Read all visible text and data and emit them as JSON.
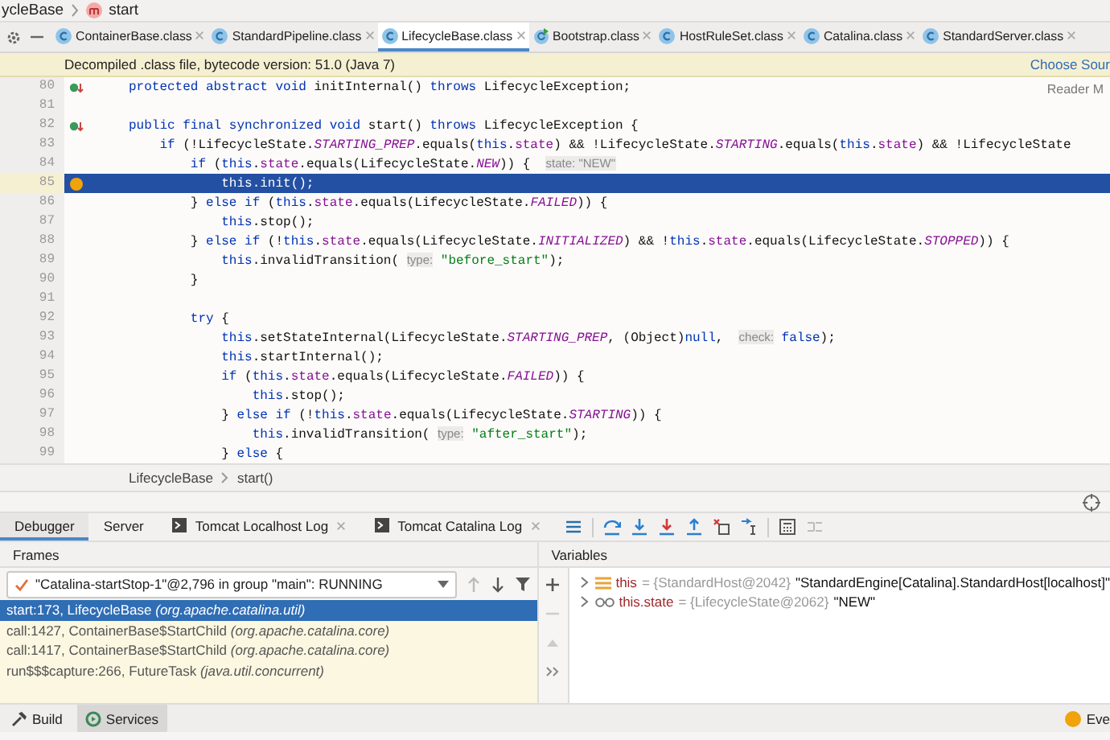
{
  "breadcrumb": {
    "class_name": "ycleBase",
    "method": "start"
  },
  "tabs": [
    {
      "label": "ContainerBase.class",
      "kind": "class",
      "selected": false
    },
    {
      "label": "StandardPipeline.class",
      "kind": "class",
      "selected": false
    },
    {
      "label": "LifecycleBase.class",
      "kind": "class",
      "selected": true
    },
    {
      "label": "Bootstrap.class",
      "kind": "runnable",
      "selected": false
    },
    {
      "label": "HostRuleSet.class",
      "kind": "class",
      "selected": false
    },
    {
      "label": "Catalina.class",
      "kind": "class",
      "selected": false
    },
    {
      "label": "StandardServer.class",
      "kind": "class",
      "selected": false
    }
  ],
  "notice": {
    "text": "Decompiled .class file, bytecode version: 51.0 (Java 7)",
    "link": "Choose Sour"
  },
  "editor": {
    "reader_mode": "Reader M",
    "lines": [
      {
        "number": "80",
        "kind": "implements",
        "current": false,
        "tokens": [
          {
            "kind": "k",
            "text": "protected abstract void "
          },
          {
            "kind": "p",
            "text": "initInternal() "
          },
          {
            "kind": "k",
            "text": "throws "
          },
          {
            "kind": "p",
            "text": "LifecycleException;"
          }
        ]
      },
      {
        "number": "81",
        "kind": "plain",
        "current": false
      },
      {
        "number": "82",
        "kind": "implements",
        "current": false,
        "tokens": [
          {
            "kind": "k",
            "text": "public final synchronized void "
          },
          {
            "kind": "p",
            "text": "start() "
          },
          {
            "kind": "k",
            "text": "throws "
          },
          {
            "kind": "p",
            "text": "LifecycleException {"
          }
        ]
      },
      {
        "number": "83",
        "kind": "plain",
        "current": false,
        "tokens": [
          {
            "kind": "k",
            "text": "    if "
          },
          {
            "kind": "p",
            "text": "(!LifecycleState."
          },
          {
            "kind": "c",
            "text": "STARTING_PREP"
          },
          {
            "kind": "p",
            "text": ".equals("
          },
          {
            "kind": "k",
            "text": "this"
          },
          {
            "kind": "p",
            "text": "."
          },
          {
            "kind": "f",
            "text": "state"
          },
          {
            "kind": "p",
            "text": ") && !LifecycleState."
          },
          {
            "kind": "c",
            "text": "STARTING"
          },
          {
            "kind": "p",
            "text": ".equals("
          },
          {
            "kind": "k",
            "text": "this"
          },
          {
            "kind": "p",
            "text": "."
          },
          {
            "kind": "f",
            "text": "state"
          },
          {
            "kind": "p",
            "text": ") && !LifecycleState"
          }
        ]
      },
      {
        "number": "84",
        "kind": "plain",
        "current": false,
        "tokens": [
          {
            "kind": "k",
            "text": "        if "
          },
          {
            "kind": "p",
            "text": "("
          },
          {
            "kind": "k",
            "text": "this"
          },
          {
            "kind": "p",
            "text": "."
          },
          {
            "kind": "f",
            "text": "state"
          },
          {
            "kind": "p",
            "text": ".equals(LifecycleState."
          },
          {
            "kind": "c",
            "text": "NEW"
          },
          {
            "kind": "p",
            "text": ")) {  "
          },
          {
            "kind": "h",
            "text": "state: \"NEW\""
          }
        ]
      },
      {
        "number": "85",
        "kind": "execution",
        "current": true,
        "tokens": [
          {
            "kind": "k",
            "text": "            this"
          },
          {
            "kind": "p",
            "text": ".init();"
          }
        ]
      },
      {
        "number": "86",
        "kind": "plain",
        "current": false,
        "tokens": [
          {
            "kind": "p",
            "text": "        } "
          },
          {
            "kind": "k",
            "text": "else if "
          },
          {
            "kind": "p",
            "text": "("
          },
          {
            "kind": "k",
            "text": "this"
          },
          {
            "kind": "p",
            "text": "."
          },
          {
            "kind": "f",
            "text": "state"
          },
          {
            "kind": "p",
            "text": ".equals(LifecycleState."
          },
          {
            "kind": "c",
            "text": "FAILED"
          },
          {
            "kind": "p",
            "text": ")) {"
          }
        ]
      },
      {
        "number": "87",
        "kind": "plain",
        "current": false,
        "tokens": [
          {
            "kind": "k",
            "text": "            this"
          },
          {
            "kind": "p",
            "text": ".stop();"
          }
        ]
      },
      {
        "number": "88",
        "kind": "plain",
        "current": false,
        "tokens": [
          {
            "kind": "p",
            "text": "        } "
          },
          {
            "kind": "k",
            "text": "else if "
          },
          {
            "kind": "p",
            "text": "(!"
          },
          {
            "kind": "k",
            "text": "this"
          },
          {
            "kind": "p",
            "text": "."
          },
          {
            "kind": "f",
            "text": "state"
          },
          {
            "kind": "p",
            "text": ".equals(LifecycleState."
          },
          {
            "kind": "c",
            "text": "INITIALIZED"
          },
          {
            "kind": "p",
            "text": ") && !"
          },
          {
            "kind": "k",
            "text": "this"
          },
          {
            "kind": "p",
            "text": "."
          },
          {
            "kind": "f",
            "text": "state"
          },
          {
            "kind": "p",
            "text": ".equals(LifecycleState."
          },
          {
            "kind": "c",
            "text": "STOPPED"
          },
          {
            "kind": "p",
            "text": ")) {"
          }
        ]
      },
      {
        "number": "89",
        "kind": "plain",
        "current": false,
        "tokens": [
          {
            "kind": "k",
            "text": "            this"
          },
          {
            "kind": "p",
            "text": ".invalidTransition( "
          },
          {
            "kind": "h",
            "text": "type:"
          },
          {
            "kind": "s",
            "text": " \"before_start\""
          },
          {
            "kind": "p",
            "text": ");"
          }
        ]
      },
      {
        "number": "90",
        "kind": "plain",
        "current": false,
        "tokens": [
          {
            "kind": "p",
            "text": "        }"
          }
        ]
      },
      {
        "number": "91",
        "kind": "plain",
        "current": false
      },
      {
        "number": "92",
        "kind": "plain",
        "current": false,
        "tokens": [
          {
            "kind": "k",
            "text": "        try "
          },
          {
            "kind": "p",
            "text": "{"
          }
        ]
      },
      {
        "number": "93",
        "kind": "plain",
        "current": false,
        "tokens": [
          {
            "kind": "k",
            "text": "            this"
          },
          {
            "kind": "p",
            "text": ".setStateInternal(LifecycleState."
          },
          {
            "kind": "c",
            "text": "STARTING_PREP"
          },
          {
            "kind": "p",
            "text": ", (Object)"
          },
          {
            "kind": "k",
            "text": "null"
          },
          {
            "kind": "p",
            "text": ",  "
          },
          {
            "kind": "h",
            "text": "check:"
          },
          {
            "kind": "k",
            "text": " false"
          },
          {
            "kind": "p",
            "text": ");"
          }
        ]
      },
      {
        "number": "94",
        "kind": "plain",
        "current": false,
        "tokens": [
          {
            "kind": "k",
            "text": "            this"
          },
          {
            "kind": "p",
            "text": ".startInternal();"
          }
        ]
      },
      {
        "number": "95",
        "kind": "plain",
        "current": false,
        "tokens": [
          {
            "kind": "k",
            "text": "            if "
          },
          {
            "kind": "p",
            "text": "("
          },
          {
            "kind": "k",
            "text": "this"
          },
          {
            "kind": "p",
            "text": "."
          },
          {
            "kind": "f",
            "text": "state"
          },
          {
            "kind": "p",
            "text": ".equals(LifecycleState."
          },
          {
            "kind": "c",
            "text": "FAILED"
          },
          {
            "kind": "p",
            "text": ")) {"
          }
        ]
      },
      {
        "number": "96",
        "kind": "plain",
        "current": false,
        "tokens": [
          {
            "kind": "k",
            "text": "                this"
          },
          {
            "kind": "p",
            "text": ".stop();"
          }
        ]
      },
      {
        "number": "97",
        "kind": "plain",
        "current": false,
        "tokens": [
          {
            "kind": "p",
            "text": "            } "
          },
          {
            "kind": "k",
            "text": "else if "
          },
          {
            "kind": "p",
            "text": "(!"
          },
          {
            "kind": "k",
            "text": "this"
          },
          {
            "kind": "p",
            "text": "."
          },
          {
            "kind": "f",
            "text": "state"
          },
          {
            "kind": "p",
            "text": ".equals(LifecycleState."
          },
          {
            "kind": "c",
            "text": "STARTING"
          },
          {
            "kind": "p",
            "text": ")) {"
          }
        ]
      },
      {
        "number": "98",
        "kind": "plain",
        "current": false,
        "tokens": [
          {
            "kind": "k",
            "text": "                this"
          },
          {
            "kind": "p",
            "text": ".invalidTransition( "
          },
          {
            "kind": "h",
            "text": "type:"
          },
          {
            "kind": "s",
            "text": " \"after_start\""
          },
          {
            "kind": "p",
            "text": ");"
          }
        ]
      },
      {
        "number": "99",
        "kind": "plain",
        "current": false,
        "tokens": [
          {
            "kind": "p",
            "text": "            } "
          },
          {
            "kind": "k",
            "text": "else "
          },
          {
            "kind": "p",
            "text": "{"
          }
        ]
      }
    ]
  },
  "editor_breadcrumb": [
    "LifecycleBase",
    "start()"
  ],
  "debug_tabs": [
    {
      "label": "Debugger",
      "kind": "plain",
      "selected": true
    },
    {
      "label": "Server",
      "kind": "plain",
      "selected": false
    },
    {
      "label": "Tomcat Localhost Log",
      "kind": "log",
      "selected": false
    },
    {
      "label": "Tomcat Catalina Log",
      "kind": "log",
      "selected": false
    }
  ],
  "frames": {
    "title": "Frames",
    "thread": "\"Catalina-startStop-1\"@2,796 in group \"main\": RUNNING",
    "items": [
      {
        "text": "start:173, LifecycleBase *(org.apache.catalina.util)*",
        "selected": true
      },
      {
        "text": "call:1427, ContainerBase$StartChild *(org.apache.catalina.core)*",
        "selected": false
      },
      {
        "text": "call:1417, ContainerBase$StartChild *(org.apache.catalina.core)*",
        "selected": false
      },
      {
        "text": "run$$$capture:266, FutureTask *(java.util.concurrent)*",
        "selected": false
      }
    ]
  },
  "variables": {
    "title": "Variables",
    "items": [
      {
        "kind": "field",
        "expanded": false,
        "name": "this",
        "detail": "= {StandardHost@2042}",
        "value": "\"StandardEngine[Catalina].StandardHost[localhost]\""
      },
      {
        "kind": "watch",
        "expanded": false,
        "name": "this.state",
        "detail": "= {LifecycleState@2062}",
        "value": "\"NEW\""
      }
    ]
  },
  "status_bar": {
    "items": [
      {
        "kind": "build",
        "label": "Build",
        "selected": false
      },
      {
        "kind": "services",
        "label": "Services",
        "selected": true
      }
    ],
    "right": "Eve"
  }
}
